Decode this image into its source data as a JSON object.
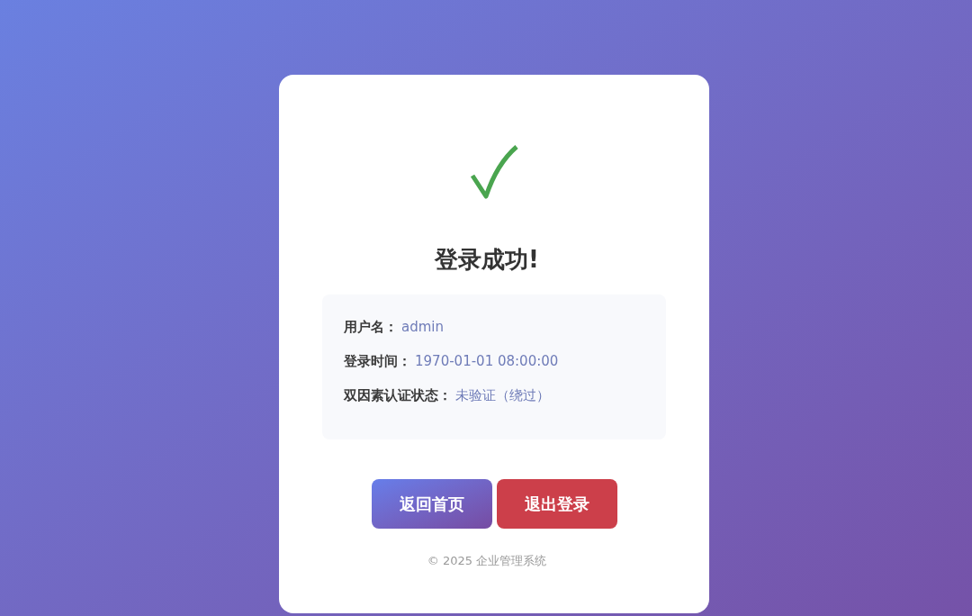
{
  "status": {
    "title": "登录成功!"
  },
  "details": [
    {
      "label": "用户名：",
      "value": "admin"
    },
    {
      "label": "登录时间：",
      "value": "1970-01-01 08:00:00"
    },
    {
      "label": "双因素认证状态：",
      "value": "未验证（绕过）"
    }
  ],
  "buttons": [
    {
      "label": "返回首页",
      "kind": "primary"
    },
    {
      "label": "退出登录",
      "kind": "danger"
    }
  ],
  "footer": "© 2025 企业管理系统"
}
